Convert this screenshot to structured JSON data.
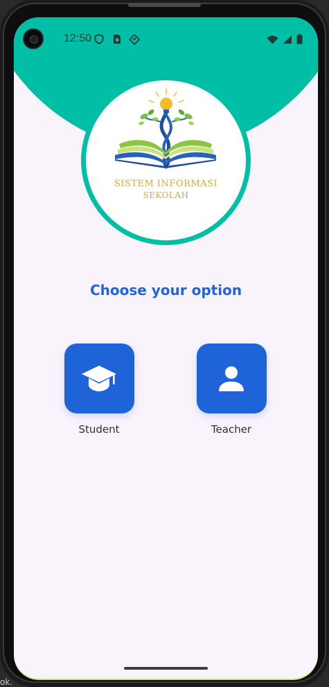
{
  "status_bar": {
    "time": "12:50",
    "left_icons": [
      "shield-icon",
      "sim-card-icon",
      "diamond-nav-icon"
    ],
    "right_icons": [
      "wifi-icon",
      "signal-icon",
      "battery-icon"
    ]
  },
  "logo": {
    "line1": "SISTEM INFORMASI",
    "line2": "SEKOLAH"
  },
  "heading": "Choose your option",
  "options": [
    {
      "label": "Student",
      "icon": "graduation-cap-icon"
    },
    {
      "label": "Teacher",
      "icon": "person-icon"
    }
  ],
  "colors": {
    "teal": "#00bfa6",
    "primary_blue": "#1f63d9",
    "background": "#f9f3fc",
    "logo_gold": "#d1a93e"
  },
  "corner_text": "ok."
}
